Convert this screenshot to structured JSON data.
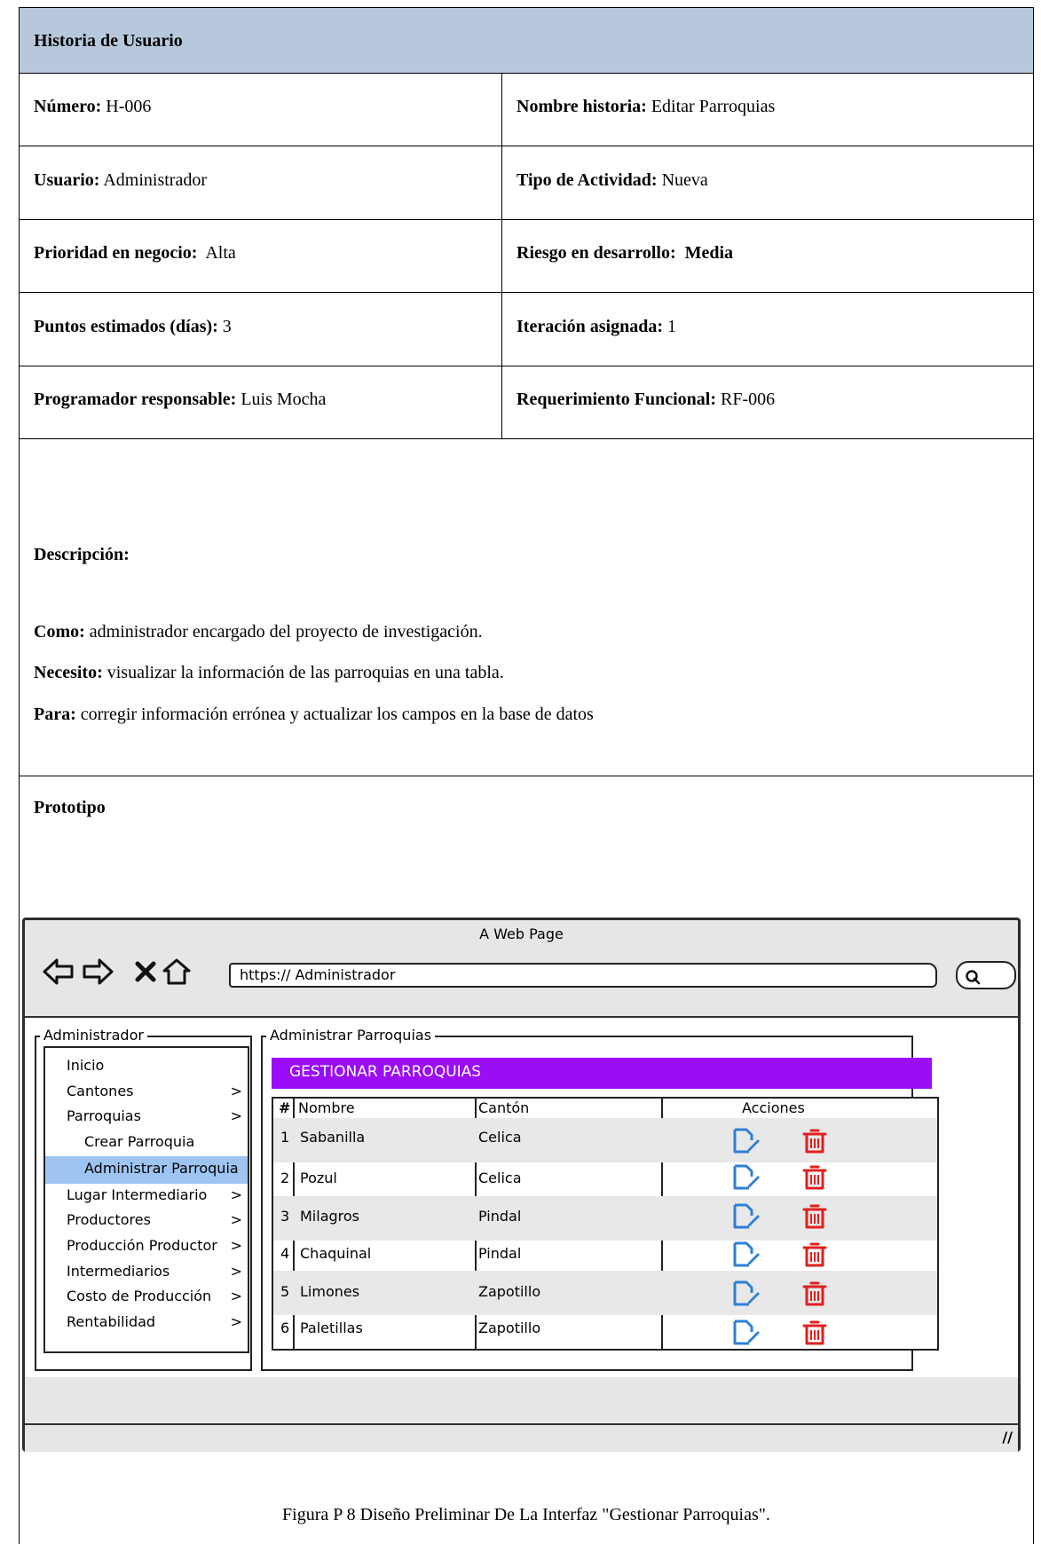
{
  "header": {
    "title": "Historia de Usuario"
  },
  "fields": {
    "numero": {
      "label": "Número:",
      "value": " H-006"
    },
    "nombre_historia": {
      "label": "Nombre historia:",
      "value": " Editar Parroquias"
    },
    "usuario": {
      "label": "Usuario:",
      "value": " Administrador"
    },
    "tipo_actividad": {
      "label": "Tipo de Actividad:",
      "value": " Nueva"
    },
    "prioridad": {
      "label": "Prioridad en negocio:",
      "value": "  Alta"
    },
    "riesgo": {
      "label": "Riesgo en desarrollo:",
      "value": "  Media"
    },
    "puntos": {
      "label": "Puntos estimados (días):",
      "value": " 3"
    },
    "iteracion": {
      "label": "Iteración asignada:",
      "value": " 1"
    },
    "programador": {
      "label": "Programador responsable:",
      "value": " Luis Mocha"
    },
    "requerimiento": {
      "label": "Requerimiento Funcional:",
      "value": " RF-006"
    }
  },
  "description": {
    "heading": "Descripción:",
    "como_label": "Como:",
    "como": " administrador encargado del proyecto de investigación.",
    "necesito_label": "Necesito:",
    "necesito": " visualizar la información de las parroquias en una tabla.",
    "para_label": "Para:",
    "para": " corregir información errónea y actualizar los campos en la base de datos"
  },
  "prototype": {
    "heading": "Prototipo",
    "caption": "Figura P 8 Diseño Preliminar De La Interfaz \"Gestionar Parroquias\".",
    "browser": {
      "window_title": "A Web Page",
      "url": "https:// Administrador",
      "icons": [
        "back-arrow-icon",
        "forward-arrow-icon",
        "close-x-icon",
        "home-icon",
        "search-icon",
        "resize-grip-icon"
      ]
    },
    "sidebar": {
      "group_label": "Administrador",
      "items": [
        {
          "label": "Inicio",
          "chevron": ""
        },
        {
          "label": "Cantones",
          "chevron": ">"
        },
        {
          "label": "Parroquias",
          "chevron": ">"
        },
        {
          "label": "Crear Parroquia",
          "chevron": ""
        },
        {
          "label": "Administrar Parroquia",
          "chevron": ""
        },
        {
          "label": "Lugar Intermediario",
          "chevron": ">"
        },
        {
          "label": "Productores",
          "chevron": ">"
        },
        {
          "label": "Producción Productor",
          "chevron": ">"
        },
        {
          "label": "Intermediarios",
          "chevron": ">"
        },
        {
          "label": "Costo de Producción",
          "chevron": ">"
        },
        {
          "label": "Rentabilidad",
          "chevron": ">"
        }
      ]
    },
    "main": {
      "group_label": "Administrar Parroquias",
      "banner": "GESTIONAR PARROQUIAS",
      "banner_color": "#9b0cf7",
      "table": {
        "headers": [
          "#",
          "Nombre",
          "Cantón",
          "Acciones"
        ],
        "rows": [
          {
            "n": "1",
            "nombre": "Sabanilla",
            "canton": "Celica"
          },
          {
            "n": "2",
            "nombre": "Pozul",
            "canton": "Celica"
          },
          {
            "n": "3",
            "nombre": "Milagros",
            "canton": "Pindal"
          },
          {
            "n": "4",
            "nombre": "Chaquinal",
            "canton": "Pindal"
          },
          {
            "n": "5",
            "nombre": "Limones",
            "canton": "Zapotillo"
          },
          {
            "n": "6",
            "nombre": "Paletillas",
            "canton": "Zapotillo"
          }
        ],
        "edit_icon_color": "#2f7fd8",
        "delete_icon_color": "#e02020"
      }
    }
  }
}
